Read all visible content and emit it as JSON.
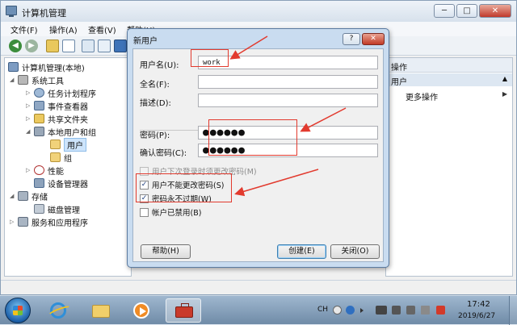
{
  "window": {
    "title": "计算机管理",
    "min_symbol": "─",
    "max_symbol": "□",
    "close_symbol": "✕"
  },
  "menubar": {
    "items": [
      "文件(F)",
      "操作(A)",
      "查看(V)",
      "帮助(H)"
    ]
  },
  "toolbar": {
    "back_symbol": "◀",
    "forward_symbol": "▶"
  },
  "tree": {
    "items": [
      {
        "label": "计算机管理(本地)",
        "icon": "computer-icon"
      },
      {
        "label": "系统工具",
        "icon": "tools-icon"
      },
      {
        "label": "任务计划程序",
        "icon": "clock-icon"
      },
      {
        "label": "事件查看器",
        "icon": "event-viewer-icon"
      },
      {
        "label": "共享文件夹",
        "icon": "shared-folder-icon"
      },
      {
        "label": "本地用户和组",
        "icon": "users-icon"
      },
      {
        "label": "用户",
        "icon": "folder-icon"
      },
      {
        "label": "组",
        "icon": "folder-icon"
      },
      {
        "label": "性能",
        "icon": "performance-icon"
      },
      {
        "label": "设备管理器",
        "icon": "device-manager-icon"
      },
      {
        "label": "存储",
        "icon": "storage-icon"
      },
      {
        "label": "磁盘管理",
        "icon": "disk-icon"
      },
      {
        "label": "服务和应用程序",
        "icon": "services-icon"
      }
    ]
  },
  "actions": {
    "header": "操作",
    "section": "用户",
    "more": "更多操作"
  },
  "dialog": {
    "title": "新用户",
    "help_symbol": "?",
    "close_symbol": "✕",
    "username_label": "用户名(U):",
    "username_value": "work",
    "fullname_label": "全名(F):",
    "fullname_value": "",
    "description_label": "描述(D):",
    "description_value": "",
    "password_label": "密码(P):",
    "password_value": "●●●●●●",
    "confirm_label": "确认密码(C):",
    "confirm_value": "●●●●●●",
    "checkboxes": [
      {
        "label": "用户下次登录时须更改密码(M)",
        "checked": false,
        "disabled": true,
        "mark": ""
      },
      {
        "label": "用户不能更改密码(S)",
        "checked": true,
        "disabled": false,
        "mark": "✓"
      },
      {
        "label": "密码永不过期(W)",
        "checked": true,
        "disabled": false,
        "mark": "✓"
      },
      {
        "label": "帐户已禁用(B)",
        "checked": false,
        "disabled": false,
        "mark": ""
      }
    ],
    "help_button": "帮助(H)",
    "create_button": "创建(E)",
    "close_button": "关闭(O)"
  },
  "taskbar": {
    "language": "CH",
    "time": "17:42",
    "date": "2019/6/27"
  },
  "colors": {
    "annotation_red": "#e23a2e",
    "selection": "#cde4fb"
  }
}
